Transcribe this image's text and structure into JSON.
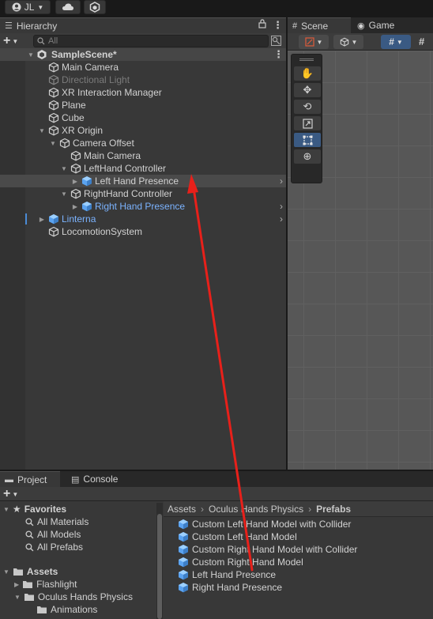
{
  "topbar": {
    "account": "JL"
  },
  "hierarchy": {
    "tab": "Hierarchy",
    "search_placeholder": "All",
    "scene_name": "SampleScene*",
    "items": [
      {
        "label": "Main Camera"
      },
      {
        "label": "Directional Light"
      },
      {
        "label": "XR Interaction Manager"
      },
      {
        "label": "Plane"
      },
      {
        "label": "Cube"
      },
      {
        "label": "XR Origin"
      },
      {
        "label": "Camera Offset"
      },
      {
        "label": "Main Camera"
      },
      {
        "label": "LeftHand Controller"
      },
      {
        "label": "Left Hand Presence"
      },
      {
        "label": "RightHand Controller"
      },
      {
        "label": "Right Hand Presence"
      },
      {
        "label": "Linterna"
      },
      {
        "label": "LocomotionSystem"
      }
    ]
  },
  "scene": {
    "tab_scene": "Scene",
    "tab_game": "Game"
  },
  "project": {
    "tab_project": "Project",
    "tab_console": "Console",
    "favorites": {
      "title": "Favorites",
      "items": [
        "All Materials",
        "All Models",
        "All Prefabs"
      ]
    },
    "assets_tree": {
      "title": "Assets",
      "items": [
        "Flashlight",
        "Oculus Hands Physics",
        "Animations"
      ]
    },
    "breadcrumb": [
      "Assets",
      "Oculus Hands Physics",
      "Prefabs"
    ],
    "files": [
      "Custom Left Hand Model with Collider",
      "Custom Left Hand Model",
      "Custom Right Hand Model with Collider",
      "Custom Right Hand Model",
      "Left Hand Presence",
      "Right Hand Presence"
    ]
  },
  "colors": {
    "prefab_blue": "#7bb3ff",
    "annotation_arrow": "#e8201a",
    "tool_active": "#3a5a83"
  }
}
